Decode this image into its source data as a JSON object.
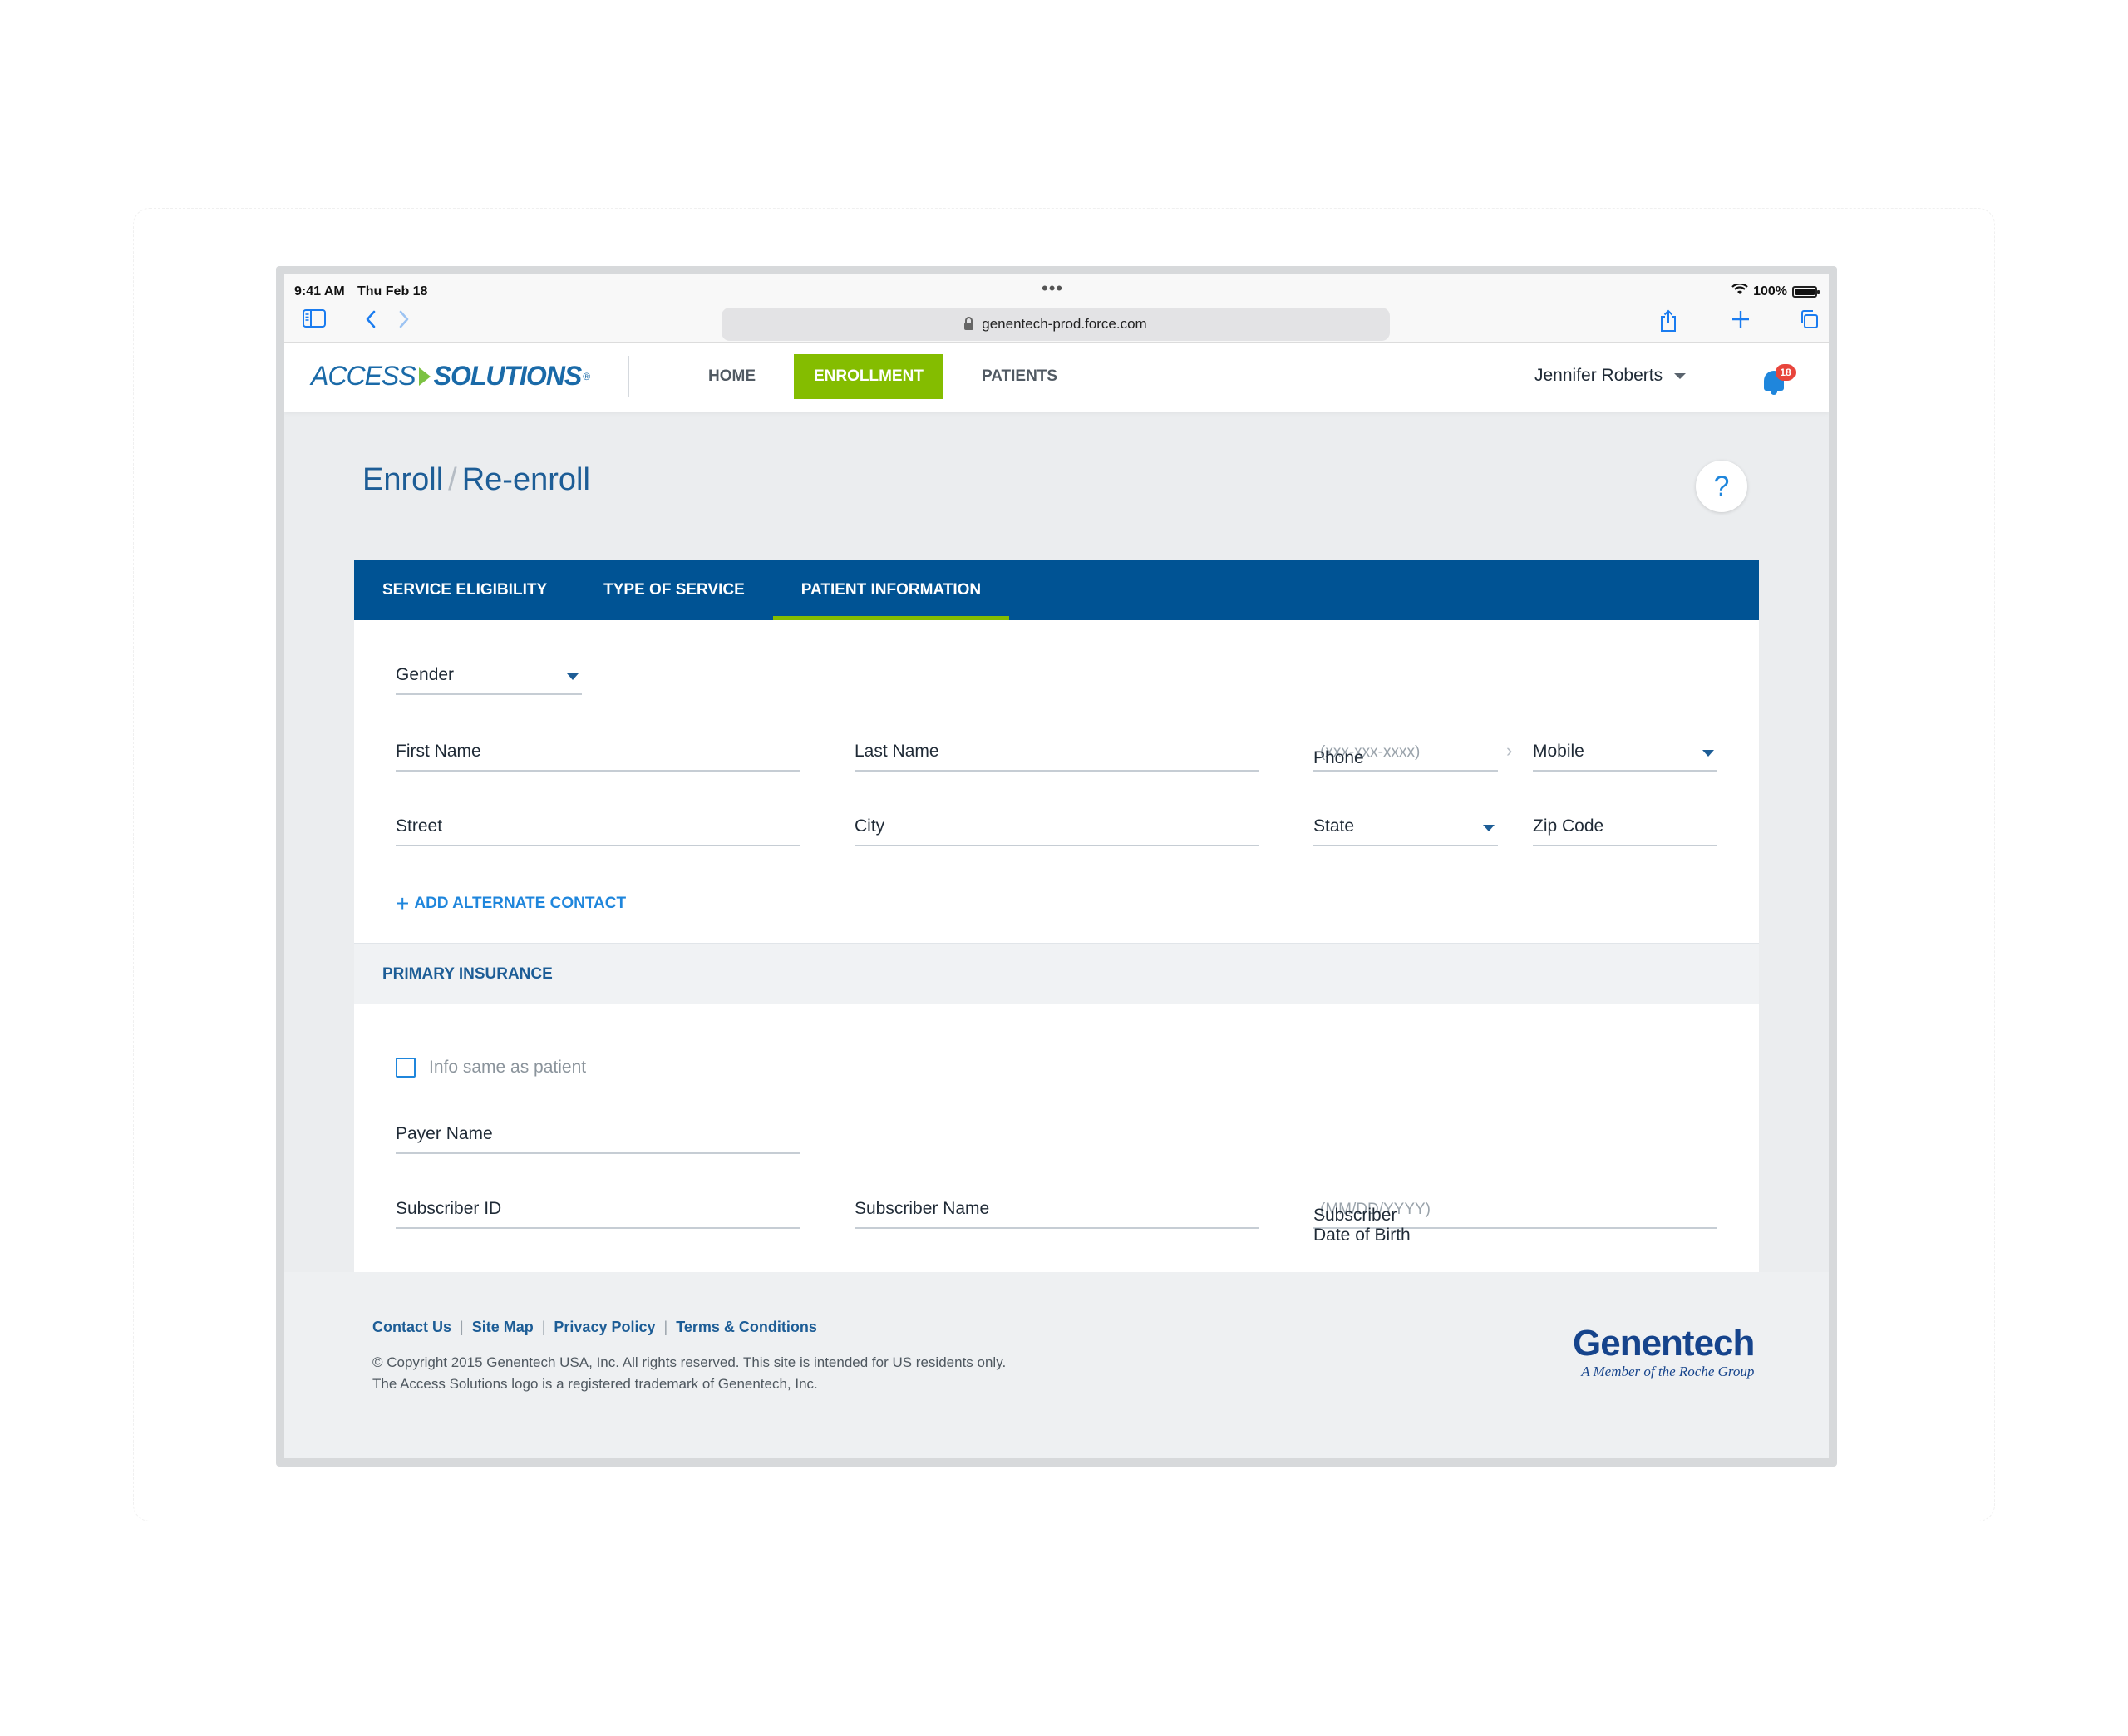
{
  "statusbar": {
    "time": "9:41 AM",
    "date": "Thu Feb 18",
    "battery": "100%"
  },
  "browser": {
    "url": "genentech-prod.force.com"
  },
  "header": {
    "logo_part1": "ACCESS",
    "logo_part2": "SOLUTIONS",
    "nav": {
      "home": "HOME",
      "enrollment": "ENROLLMENT",
      "patients": "PATIENTS"
    },
    "user_name": "Jennifer Roberts",
    "notification_count": "18"
  },
  "page": {
    "breadcrumb_1": "Enroll",
    "breadcrumb_sep": "/",
    "breadcrumb_2": "Re-enroll",
    "help": "?"
  },
  "tabs": {
    "service_eligibility": "SERVICE ELIGIBILITY",
    "type_of_service": "TYPE OF SERVICE",
    "patient_information": "PATIENT INFORMATION"
  },
  "form": {
    "gender": "Gender",
    "first_name": "First Name",
    "last_name": "Last Name",
    "phone": "Phone",
    "phone_placeholder": "(xxx-xxx-xxxx)",
    "phone_type": "Mobile",
    "street": "Street",
    "city": "City",
    "state": "State",
    "zip": "Zip Code",
    "add_alternate_contact": "ADD ALTERNATE CONTACT"
  },
  "insurance": {
    "section_title": "PRIMARY INSURANCE",
    "same_as_patient": "Info same as patient",
    "payer_name": "Payer Name",
    "subscriber_id": "Subscriber ID",
    "subscriber_name": "Subscriber Name",
    "subscriber_dob": "Subscriber Date of Birth",
    "dob_placeholder": "(MM/DD/YYYY)"
  },
  "footer": {
    "links": {
      "contact": "Contact Us",
      "sitemap": "Site Map",
      "privacy": "Privacy Policy",
      "terms": "Terms & Conditions"
    },
    "copyright": "© Copyright 2015 Genentech USA, Inc.  All rights reserved.  This site is intended for US residents only.",
    "trademark": "The Access Solutions logo is a registered trademark of Genentech, Inc.",
    "brand": "Genentech",
    "brand_tagline": "A Member of the Roche Group"
  },
  "colors": {
    "brand_blue": "#005394",
    "accent_green": "#84bd00",
    "link_blue": "#1f86dc",
    "badge_red": "#e8453c"
  }
}
